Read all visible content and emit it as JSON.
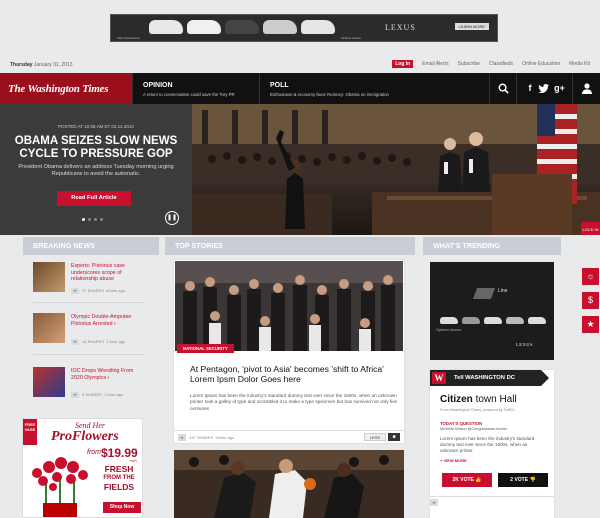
{
  "top_ad": {
    "brand": "LEXUS",
    "cta": "LEARN MORE",
    "disclaimer_left": "View Disclosures",
    "disclaimer_mid": "Options shown."
  },
  "utility": {
    "date_day": "Thursday",
    "date_rest": "January 31, 2013",
    "links": [
      "Log In",
      "Email Alerts",
      "Subscribe",
      "Classifieds",
      "Online Education",
      "Media Kit"
    ]
  },
  "header": {
    "logo": "The Washington Times",
    "opinion": {
      "title": "OPINION",
      "subtitle": "A return to conservatism could save the Tory PR"
    },
    "poll": {
      "title": "POLL",
      "subtitle": "Enthusiasm & economy favor Romney: Obama on immigration"
    },
    "icons": [
      "search-icon",
      "facebook-icon",
      "twitter-icon",
      "googleplus-icon",
      "user-icon"
    ],
    "icon_glyphs": {
      "facebook": "f",
      "googleplus": "g+",
      "user": "👤"
    }
  },
  "hero": {
    "posted": "POSTED AT 10:06 AM ET 02.14.2013",
    "headline": "OBAMA SEIZES SLOW NEWS CYCLE TO PRESSURE GOP",
    "summary": "President Obama delivers an address Tuesday morning urging Republicans to avoid the automatic.",
    "button": "Read Full Article",
    "side_tab": "LOCK IN"
  },
  "columns": {
    "breaking": "BREAKING NEWS",
    "top": "TOP STORIES",
    "trending": "WHAT'S TRENDING"
  },
  "breaking_news": [
    {
      "title": "Experts: Pistorius case underscores scope of relationship abuse",
      "shares": "37",
      "shares_label": "SHARES",
      "time": "40min ago"
    },
    {
      "title": "Olympic Double-Amputee Pistorius Arrested",
      "shares": "14",
      "shares_label": "SHARES",
      "time": "1 hour ago"
    },
    {
      "title": "IOC Drops Wrestling From 2020 Olympics",
      "shares": "8",
      "shares_label": "SHARES",
      "time": "1 hour ago"
    }
  ],
  "flowers_ad": {
    "free_vase": "FREE VASE",
    "send_her": "Send Her",
    "brand": "ProFlowers",
    "from": "from",
    "price": "$19.99",
    "price_suffix": "+s/h",
    "fresh": "FRESH",
    "from_the": "FROM THE",
    "fields": "FIELDS",
    "shop": "Shop Now"
  },
  "story1": {
    "tag": "NATIONAL SECURITY",
    "headline": "At Pentagon, 'pivot to Asia' becomes 'shift to Africa' Lorem Ipsm Dolor Goes here",
    "summary": "Lorem Ipsum has been the industry's standard dummy text ever since the 1500s, when an unknown printer took a galley of type and scrambled it to make a type specimen bot has survived not only five centuries",
    "shares": "137",
    "shares_label": "SHARES",
    "time": "40min ago",
    "less": "LESS"
  },
  "trending_ad": {
    "line": "Line",
    "brand": "LEXUS",
    "options": "Options shown."
  },
  "tell": {
    "label": "Tell WASHINGTON DC",
    "headline_bold": "Citizen",
    "headline_rest": "town Hall",
    "from": "From Washington Times, powered by TellDC",
    "question_label": "TODAY'S QUESTION",
    "author": "Michelle Kelson @Congressman.hunter",
    "body": "Lorem Ipsum has been the industry's standard dummy text ever since the 1500s, when an unknown printer",
    "more": "+ VIEW MORE",
    "vote1": "2K VOTE",
    "vote2": "2 VOTE"
  },
  "colors": {
    "brand_red": "#c8102e",
    "logo_red": "#9b0f1d",
    "header_black": "#111111",
    "colhead": "#c7cdd2"
  }
}
